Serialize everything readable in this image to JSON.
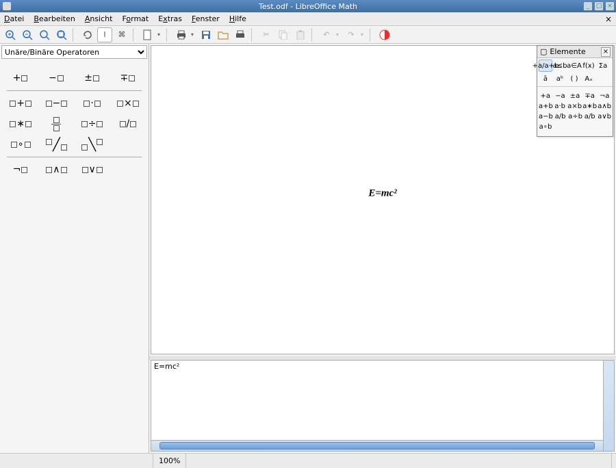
{
  "window": {
    "title": "Test.odf - LibreOffice Math"
  },
  "menubar": {
    "items": [
      "Datei",
      "Bearbeiten",
      "Ansicht",
      "Format",
      "Extras",
      "Fenster",
      "Hilfe"
    ]
  },
  "operator_panel": {
    "selected_category": "Unäre/Binäre Operatoren"
  },
  "elements_panel": {
    "title": "Elemente",
    "categories": [
      "+a/a+b",
      "a≤b",
      "a∈A",
      "f(x)",
      "Σa",
      "ā",
      "aᵇ",
      "( )",
      "Aₓ"
    ],
    "rows": [
      [
        "+a",
        "−a",
        "±a",
        "∓a",
        "¬a"
      ],
      [
        "a+b",
        "a·b",
        "a×b",
        "a∗b",
        "a∧b"
      ],
      [
        "a−b",
        "a/b",
        "a÷b",
        "a/b",
        "a∨b"
      ],
      [
        "a∘b",
        "",
        "",
        "",
        ""
      ]
    ]
  },
  "canvas": {
    "formula_display": "E=mc²"
  },
  "editor": {
    "text": "E=mc²"
  },
  "status": {
    "zoom": "100%"
  }
}
